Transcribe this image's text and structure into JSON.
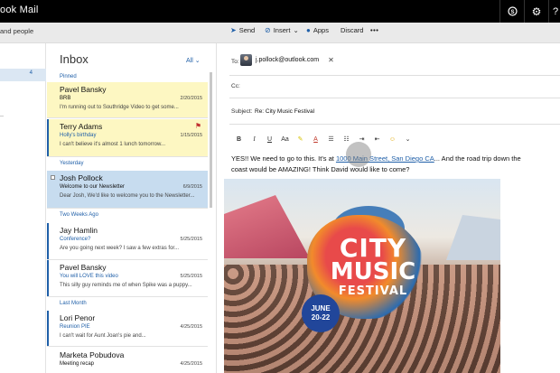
{
  "app": {
    "title": "ook Mail"
  },
  "titlebar": {
    "skype_icon": "skype-icon",
    "settings_icon": "gear-icon",
    "help_label": "?"
  },
  "commandbar": {
    "left_label": "and people",
    "send_label": "Send",
    "insert_label": "Insert",
    "apps_label": "Apps",
    "discard_label": "Discard",
    "more_label": "•••"
  },
  "folders": {
    "selected_count": "4"
  },
  "list": {
    "title": "Inbox",
    "filter_label": "All",
    "sections": {
      "pinned": "Pinned",
      "yesterday": "Yesterday",
      "two_weeks": "Two Weeks Ago",
      "last_month": "Last Month"
    },
    "messages": [
      {
        "from": "Pavel Bansky",
        "subject": "BRB",
        "date": "2/20/2015",
        "preview": "I'm running out to Southridge Video to get some..."
      },
      {
        "from": "Terry Adams",
        "subject": "Holly's birthday",
        "date": "1/15/2015",
        "preview": "I can't believe it's almost 1 lunch tomorrow..."
      },
      {
        "from": "Josh Pollock",
        "subject": "Welcome to our Newsletter",
        "date": "6/9/2015",
        "preview": "Dear Josh, We'd like to welcome you to the Newsletter..."
      },
      {
        "from": "Jay Hamlin",
        "subject": "Conference?",
        "date": "5/25/2015",
        "preview": "Are you going next week? I saw a few extras for..."
      },
      {
        "from": "Pavel Bansky",
        "subject": "You will LOVE this video",
        "date": "5/25/2015",
        "preview": "This silly guy reminds me of when Spike was a puppy..."
      },
      {
        "from": "Lori Penor",
        "subject": "Reunion PIE",
        "date": "4/25/2015",
        "preview": "I can't wait for Aunt Joan's pie and..."
      },
      {
        "from": "Marketa Pobudova",
        "subject": "Meeting recap",
        "date": "4/25/2015",
        "preview": ""
      }
    ]
  },
  "compose": {
    "to_label": "To:",
    "to_value": "j.pollock@outlook.com",
    "cc_label": "Cc:",
    "subject_label": "Subject:",
    "subject_value": "Re: City Music Festival",
    "body_start": "YES!!  We need to go to this. It's at ",
    "body_link": "1000 Main Street, San Diego CA",
    "body_end": "... And the road trip down the coast would be AMAZING! Think David would like to come?",
    "format_buttons": [
      "B",
      "I",
      "U",
      "Aa",
      "A",
      "A"
    ],
    "poster": {
      "line1": "CITY",
      "line2": "MUSIC",
      "line3": "FESTIVAL",
      "date1": "JUNE",
      "date2": "20-22"
    }
  }
}
